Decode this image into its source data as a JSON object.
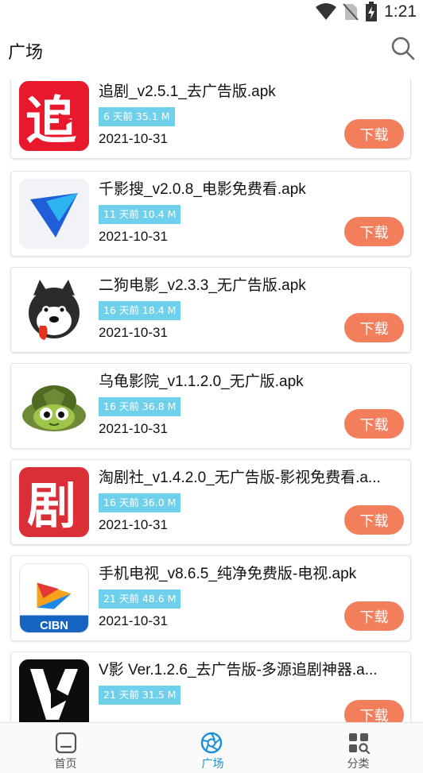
{
  "status": {
    "time": "1:21"
  },
  "header": {
    "title": "广场"
  },
  "apps": [
    {
      "name": "追剧_v2.5.1_去广告版.apk",
      "badge": "6 天前 35.1 M",
      "date": "2021-10-31",
      "button": "下载",
      "icon": "zhuiju-app-icon"
    },
    {
      "name": "千影搜_v2.0.8_电影免费看.apk",
      "badge": "11 天前 10.4 M",
      "date": "2021-10-31",
      "button": "下载",
      "icon": "qianyingsou-app-icon"
    },
    {
      "name": "二狗电影_v2.3.3_无广告版.apk",
      "badge": "16 天前 18.4 M",
      "date": "2021-10-31",
      "button": "下载",
      "icon": "ergou-dog-app-icon"
    },
    {
      "name": "乌龟影院_v1.1.2.0_无广版.apk",
      "badge": "16 天前 36.8 M",
      "date": "2021-10-31",
      "button": "下载",
      "icon": "turtle-app-icon"
    },
    {
      "name": "淘剧社_v1.4.2.0_无广告版-影视免费看.a...",
      "badge": "16 天前 36.0 M",
      "date": "2021-10-31",
      "button": "下载",
      "icon": "taojushe-app-icon"
    },
    {
      "name": "手机电视_v8.6.5_纯净免费版-电视.apk",
      "badge": "21 天前 48.6 M",
      "date": "2021-10-31",
      "button": "下载",
      "icon": "cibn-app-icon",
      "icon_text": "CIBN"
    },
    {
      "name": "V影 Ver.1.2.6_去广告版-多源追剧神器.a...",
      "badge": "21 天前 31.5 M",
      "date": "",
      "button": "下载",
      "icon": "vying-app-icon"
    }
  ],
  "icon_texts": {
    "zhuiju": "追",
    "taojushe": "剧",
    "cibn": "CIBN"
  },
  "nav": {
    "home": "首页",
    "square": "广场",
    "category": "分类"
  },
  "colors": {
    "accent": "#1a90d8",
    "download_button": "#f37e5c",
    "badge": "#6fd0ec"
  }
}
